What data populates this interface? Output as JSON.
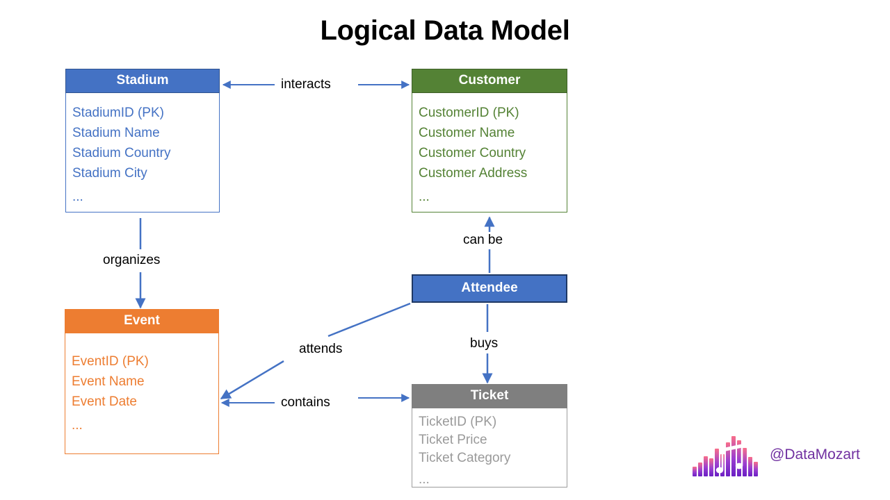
{
  "page": {
    "title": "Logical Data Model",
    "background": "#FFFFFF"
  },
  "colors": {
    "stadium": "#4472C4",
    "customer": "#548235",
    "event": "#ED7D31",
    "attendee": "#4472C4",
    "attendee_border": "#1F3864",
    "ticket": "#7F7F7F",
    "connector": "#4472C4",
    "label_text": "#000000",
    "watermark": "#7030A0"
  },
  "entities": {
    "stadium": {
      "name": "Stadium",
      "attributes": [
        "StadiumID (PK)",
        "Stadium Name",
        "Stadium Country",
        "Stadium City"
      ],
      "ellipsis": "..."
    },
    "customer": {
      "name": "Customer",
      "attributes": [
        "CustomerID (PK)",
        "Customer Name",
        "Customer Country",
        "Customer Address"
      ],
      "ellipsis": "..."
    },
    "event": {
      "name": "Event",
      "attributes": [
        "EventID (PK)",
        "Event Name",
        "Event Date"
      ],
      "ellipsis": "..."
    },
    "attendee": {
      "name": "Attendee",
      "attributes": [],
      "ellipsis": ""
    },
    "ticket": {
      "name": "Ticket",
      "attributes": [
        "TicketID (PK)",
        "Ticket Price",
        "Ticket Category"
      ],
      "ellipsis": "..."
    }
  },
  "relationships": {
    "interacts": {
      "label": "interacts",
      "from": "Stadium",
      "to": "Customer",
      "direction": "bidirectional"
    },
    "organizes": {
      "label": "organizes",
      "from": "Stadium",
      "to": "Event",
      "direction": "down"
    },
    "can_be": {
      "label": "can be",
      "from": "Attendee",
      "to": "Customer",
      "direction": "up"
    },
    "attends": {
      "label": "attends",
      "from": "Attendee",
      "to": "Event",
      "direction": "diagonal"
    },
    "buys": {
      "label": "buys",
      "from": "Attendee",
      "to": "Ticket",
      "direction": "down"
    },
    "contains": {
      "label": "contains",
      "from": "Event",
      "to": "Ticket",
      "direction": "bidirectional"
    }
  },
  "watermark": {
    "handle": "@DataMozart",
    "logo": "music-equalizer-logo"
  }
}
